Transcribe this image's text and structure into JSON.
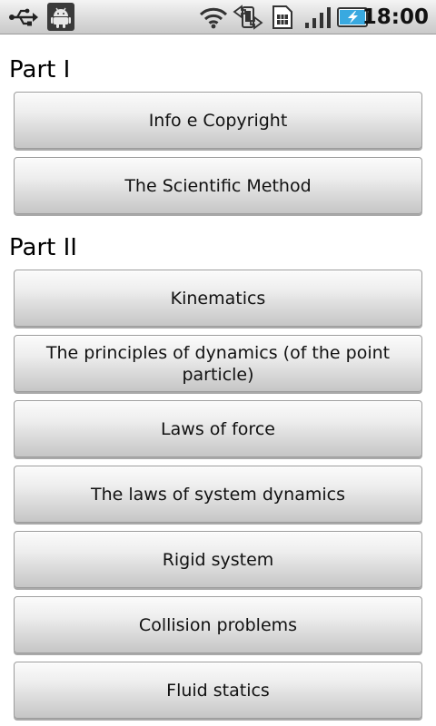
{
  "status_bar": {
    "time": "18:00",
    "icons": [
      "usb-icon",
      "android-debug-icon",
      "wifi-icon",
      "data-transfer-icon",
      "sim-card-icon",
      "signal-bars-icon",
      "battery-charging-icon"
    ],
    "battery_color": "#39a9e0"
  },
  "sections": [
    {
      "title": "Part I",
      "items": [
        "Info e Copyright",
        "The Scientific Method"
      ]
    },
    {
      "title": "Part II",
      "items": [
        "Kinematics",
        "The principles of dynamics (of the point particle)",
        "Laws of force",
        "The laws of system dynamics",
        "Rigid system",
        "Collision problems",
        "Fluid statics"
      ]
    }
  ]
}
